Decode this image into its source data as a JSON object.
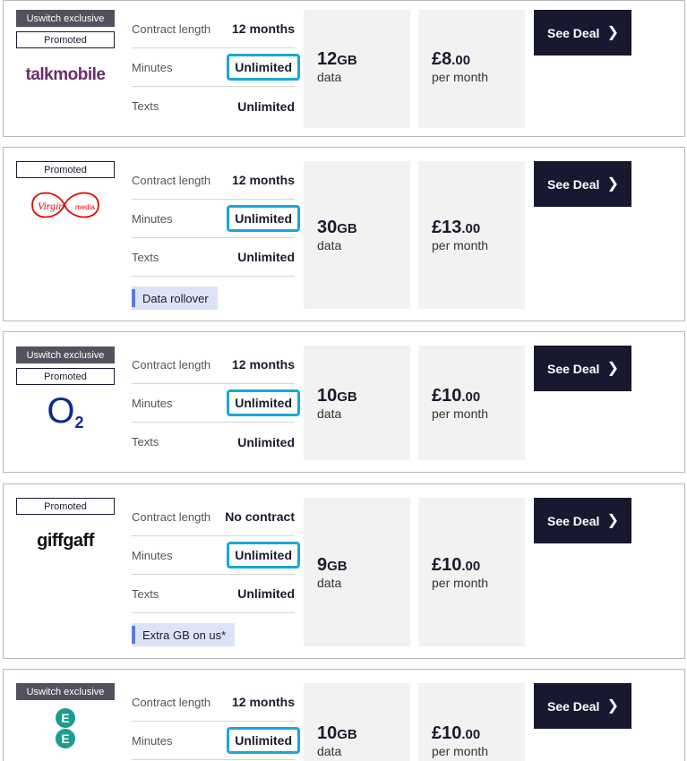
{
  "labels": {
    "contract": "Contract length",
    "minutes": "Minutes",
    "texts": "Texts",
    "data_suffix": "data",
    "price_suffix": "per month",
    "cta": "See Deal",
    "exclusive": "Uswitch exclusive",
    "promoted": "Promoted"
  },
  "deals": [
    {
      "brand": "talkmobile",
      "contract": "12 months",
      "minutes": "Unlimited",
      "texts": "Unlimited",
      "data_num": "12",
      "data_unit": "GB",
      "price_main": "£8",
      "price_dec": ".00"
    },
    {
      "brand_word1": "Virgin",
      "brand_word2": "media",
      "contract": "12 months",
      "minutes": "Unlimited",
      "texts": "Unlimited",
      "data_num": "30",
      "data_unit": "GB",
      "price_main": "£13",
      "price_dec": ".00",
      "feature": "Data rollover"
    },
    {
      "brand": "O",
      "brand_sub": "2",
      "contract": "12 months",
      "minutes": "Unlimited",
      "texts": "Unlimited",
      "data_num": "10",
      "data_unit": "GB",
      "price_main": "£10",
      "price_dec": ".00"
    },
    {
      "brand": "giffgaff",
      "contract": "No contract",
      "minutes": "Unlimited",
      "texts": "Unlimited",
      "data_num": "9",
      "data_unit": "GB",
      "price_main": "£10",
      "price_dec": ".00",
      "feature": "Extra GB on us*"
    },
    {
      "brand_letter": "E",
      "contract": "12 months",
      "minutes": "Unlimited",
      "data_num": "10",
      "data_unit": "GB",
      "price_main": "£10",
      "price_dec": ".00"
    }
  ],
  "colors": {
    "cta_bg": "#181830",
    "highlight_border": "#19a7dc",
    "talkmobile": "#6b2c6e",
    "virgin": "#e10a0a",
    "o2": "#0a2d8c",
    "ee": "#1a9c8f"
  }
}
